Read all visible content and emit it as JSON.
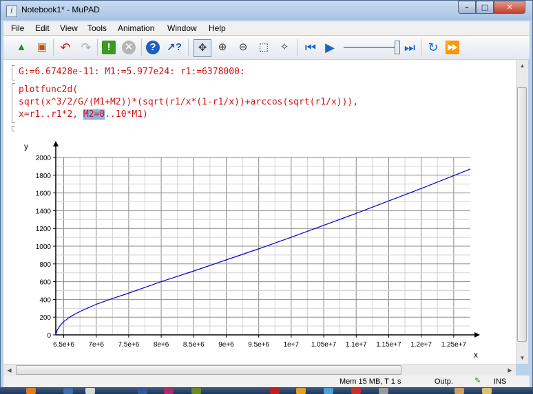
{
  "window": {
    "title": "Notebook1* - MuPAD",
    "app_icon_glyph": "ƒ"
  },
  "menu": [
    "File",
    "Edit",
    "View",
    "Tools",
    "Animation",
    "Window",
    "Help"
  ],
  "toolbar": {
    "icons": [
      "new-notebook-icon",
      "save-icon",
      "undo-icon",
      "redo-icon",
      "evaluate-icon",
      "stop-icon",
      "help-icon",
      "context-help-icon",
      "pan-icon",
      "zoom-in-icon",
      "zoom-out-icon",
      "zoom-box-icon",
      "rotate-icon",
      "animation-start-icon",
      "animation-play-icon",
      "animation-end-icon",
      "animation-loop-icon",
      "animation-fast-icon"
    ],
    "animation_position": 1.0
  },
  "notebook": {
    "input1": "G:=6.67428e-11: M1:=5.977e24: r1:=6378000:",
    "input2_line1": "plotfunc2d(",
    "input2_line2": "sqrt(x^3/2/G/(M1+M2))*(sqrt(r1/x*(1-r1/x))+arccos(sqrt(r1/x))),",
    "input2_line3_pre": "x=r1..r1*2, ",
    "input2_line3_sel": "M2=0",
    "input2_line3_post": "..10*M1)"
  },
  "chart_data": {
    "type": "line",
    "xlabel": "x",
    "ylabel": "y",
    "xlim": [
      6378000,
      12756000
    ],
    "ylim": [
      0,
      2000
    ],
    "x_ticks": [
      6500000,
      7000000,
      7500000,
      8000000,
      8500000,
      9000000,
      9500000,
      10000000,
      10500000,
      11000000,
      11500000,
      12000000,
      12500000
    ],
    "x_tick_labels": [
      "6.5e+6",
      "7e+6",
      "7.5e+6",
      "8e+6",
      "8.5e+6",
      "9e+6",
      "9.5e+6",
      "1e+7",
      "1.05e+7",
      "1.1e+7",
      "1.15e+7",
      "1.2e+7",
      "1.25e+7"
    ],
    "y_ticks": [
      0,
      200,
      400,
      600,
      800,
      1000,
      1200,
      1400,
      1600,
      1800,
      2000
    ],
    "grid": true,
    "series": [
      {
        "color": "#0000cc",
        "x": [
          6378000,
          6400000,
          6450000,
          6500000,
          6600000,
          6700000,
          6800000,
          7000000,
          7250000,
          7500000,
          7750000,
          8000000,
          8500000,
          9000000,
          9500000,
          10000000,
          10500000,
          11000000,
          11500000,
          12000000,
          12500000,
          12756000
        ],
        "y": [
          0,
          55,
          110,
          150,
          203,
          245,
          280,
          345,
          410,
          470,
          535,
          600,
          720,
          845,
          970,
          1100,
          1235,
          1370,
          1510,
          1650,
          1795,
          1870
        ]
      }
    ]
  },
  "status": {
    "mem": "Mem 15 MB, T 1 s",
    "mode": "Outp.",
    "ins": "INS"
  },
  "colors": {
    "code": "#d01414",
    "curve": "#0000cc",
    "selection": "#8fb2e0"
  }
}
